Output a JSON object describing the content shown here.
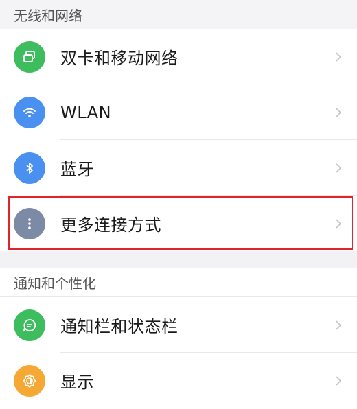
{
  "sections": [
    {
      "title": "无线和网络",
      "items": [
        {
          "label": "双卡和移动网络",
          "icon": "sim-cards-icon",
          "color": "#3dbd5e"
        },
        {
          "label": "WLAN",
          "icon": "wifi-icon",
          "color": "#4a90f0"
        },
        {
          "label": "蓝牙",
          "icon": "bluetooth-icon",
          "color": "#4a90f0"
        },
        {
          "label": "更多连接方式",
          "icon": "more-dots-icon",
          "color": "#7d8aa6"
        }
      ]
    },
    {
      "title": "通知和个性化",
      "items": [
        {
          "label": "通知栏和状态栏",
          "icon": "message-bubble-icon",
          "color": "#3dbd5e"
        },
        {
          "label": "显示",
          "icon": "brightness-icon",
          "color": "#f5a833"
        }
      ]
    }
  ],
  "highlight_color": "#e0242b"
}
